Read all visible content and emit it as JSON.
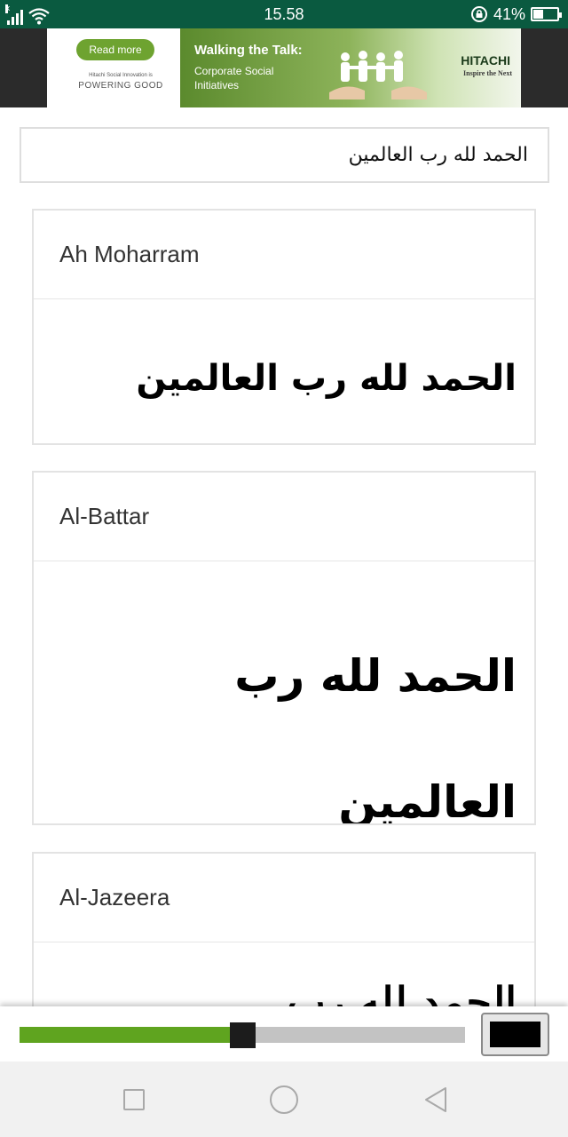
{
  "status_bar": {
    "time": "15.58",
    "battery_percent": "41%",
    "battery_level": 0.41,
    "sim_marker": "x",
    "icons": [
      "signal-icon",
      "wifi-icon",
      "data-saver-icon",
      "battery-icon"
    ]
  },
  "ad": {
    "button_label": "Read more",
    "tagline_small": "Hitachi Social Innovation is",
    "tagline_big": "POWERING GOOD",
    "title": "Walking the Talk:",
    "subtitle": "Corporate Social Initiatives",
    "brand": "HITACHI",
    "brand_tagline": "Inspire the Next",
    "colors": {
      "accent_green": "#6ea330",
      "background_green": "#5b8a2d"
    }
  },
  "input": {
    "value": "الحمد لله رب العالمين"
  },
  "fonts": [
    {
      "name": "Ah Moharram",
      "sample": "الحمد لله رب العالمين"
    },
    {
      "name": "Al-Battar",
      "sample_lines": [
        "الحمد لله رب",
        "العالمين"
      ]
    },
    {
      "name": "Al-Jazeera",
      "sample": "الحمد لله رب"
    }
  ],
  "controls": {
    "size_slider_value": 0.5,
    "text_color": "#000000",
    "slider_fill_color": "#5fa41f"
  },
  "nav": {
    "icons": [
      "recents-square-icon",
      "home-circle-icon",
      "back-triangle-icon"
    ]
  },
  "theme": {
    "status_bar_bg": "#0a5a40"
  }
}
